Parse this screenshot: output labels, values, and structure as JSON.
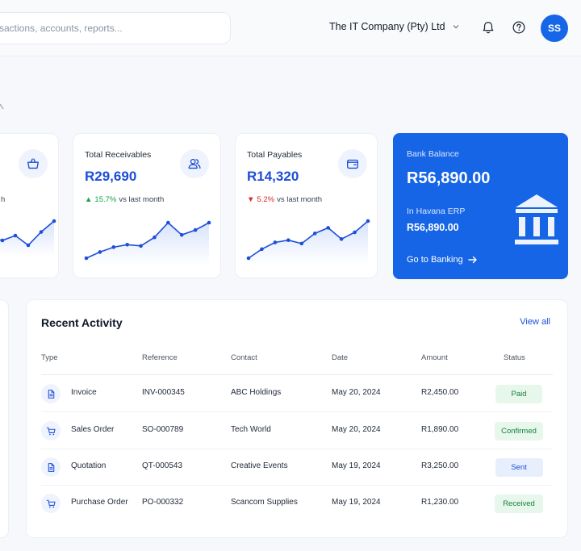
{
  "header": {
    "search_placeholder": "sactions, accounts, reports...",
    "company_name": "The IT Company (Pty) Ltd",
    "avatar_initials": "SS",
    "accent_color": "#1667e8"
  },
  "cards": [
    {
      "title": "Total Receivables",
      "value": "R29,690",
      "trend_arrow": "▲",
      "trend_percent": "15.7%",
      "trend_label": "vs last month",
      "trend_direction": "up",
      "icon": "users-icon",
      "sparkline": [
        3,
        8,
        12,
        14,
        13,
        20,
        32,
        22,
        26,
        32
      ]
    },
    {
      "title": "Total Payables",
      "value": "R14,320",
      "trend_arrow": "▼",
      "trend_percent": "5.2%",
      "trend_label": "vs last month",
      "trend_direction": "down",
      "icon": "wallet-icon",
      "sparkline": [
        3,
        11,
        17,
        19,
        16,
        25,
        30,
        20,
        26,
        36
      ]
    }
  ],
  "partial_card": {
    "icon": "basket-icon",
    "trend_fragment": "h",
    "sparkline": [
      22,
      20,
      24,
      16,
      27,
      36
    ]
  },
  "bank": {
    "title": "Bank Balance",
    "value": "R56,890.00",
    "sub_label": "In Havana ERP",
    "sub_value": "R56,890.00",
    "link_label": "Go to Banking",
    "icon": "bank-building-icon"
  },
  "activity": {
    "title": "Recent Activity",
    "view_all": "View all",
    "columns": [
      "Type",
      "Reference",
      "Contact",
      "Date",
      "Amount",
      "Status"
    ],
    "rows": [
      {
        "type": "Invoice",
        "icon": "document-icon",
        "reference": "INV-000345",
        "contact": "ABC Holdings",
        "date": "May 20, 2024",
        "amount": "R2,450.00",
        "status": "Paid",
        "status_bg": "#e8f7ec",
        "status_color": "#15803d"
      },
      {
        "type": "Sales Order",
        "icon": "cart-icon",
        "reference": "SO-000789",
        "contact": "Tech World",
        "date": "May 20, 2024",
        "amount": "R1,890.00",
        "status": "Confirmed",
        "status_bg": "#e8f7ec",
        "status_color": "#15803d"
      },
      {
        "type": "Quotation",
        "icon": "document-icon",
        "reference": "QT-000543",
        "contact": "Creative Events",
        "date": "May 19, 2024",
        "amount": "R3,250.00",
        "status": "Sent",
        "status_bg": "#e7effd",
        "status_color": "#1d4ed8"
      },
      {
        "type": "Purchase Order",
        "icon": "cart-icon",
        "reference": "PO-000332",
        "contact": "Scancom Supplies",
        "date": "May 19, 2024",
        "amount": "R1,230.00",
        "status": "Received",
        "status_bg": "#e8f7ec",
        "status_color": "#15803d"
      }
    ]
  }
}
